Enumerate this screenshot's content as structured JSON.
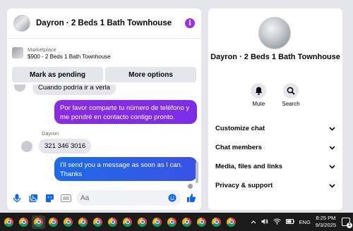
{
  "chat": {
    "title": "Dayron · 2 Beds 1 Bath Townhouse",
    "listing": {
      "source": "Marketplace",
      "price_title": "$900 - 2 Beds 1 Bath Townhouse"
    },
    "actions": {
      "mark_pending": "Mark as pending",
      "more_options": "More options"
    },
    "messages": [
      {
        "direction": "in",
        "text": "Cuando podría ir a verla"
      },
      {
        "direction": "out",
        "text": "Por favor comparte tu número de teléfono y me pondré en contacto contigo pronto."
      },
      {
        "direction": "in",
        "sender": "Dayron",
        "text": "321 346 3016"
      },
      {
        "direction": "out",
        "text": "I'll send you a message as soon as I can. Thanks"
      }
    ],
    "composer": {
      "placeholder": "Aa"
    }
  },
  "side": {
    "title": "Dayron · 2 Beds 1 Bath Townhouse",
    "buttons": {
      "mute": "Mute",
      "search": "Search"
    },
    "menu": [
      {
        "label": "Customize chat"
      },
      {
        "label": "Chat members"
      },
      {
        "label": "Media, files and links"
      },
      {
        "label": "Privacy & support"
      }
    ]
  },
  "taskbar": {
    "language": "ENG",
    "time": "8:25 PM",
    "date": "9/3/2025",
    "notification_count": "1"
  },
  "colors": {
    "bubble_out_start": "#8a2be2",
    "bubble_out_end": "#1d6be8",
    "accent": "#0866ff",
    "info_icon": "#9b2ff0"
  }
}
